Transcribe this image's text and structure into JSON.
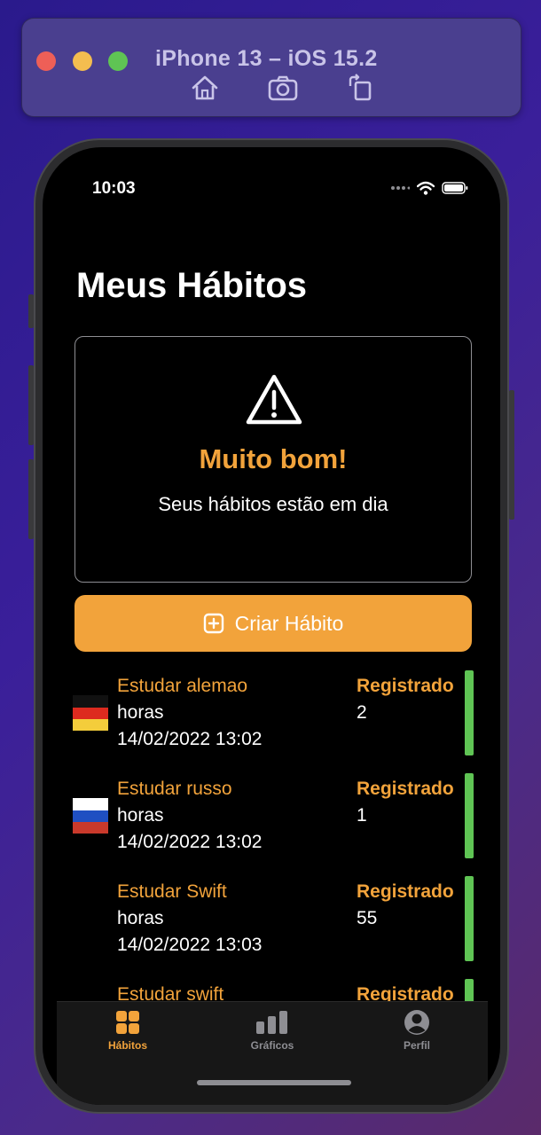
{
  "simulator": {
    "title": "iPhone 13 – iOS 15.2",
    "tools": [
      "home-icon",
      "screenshot-icon",
      "rotate-icon"
    ]
  },
  "status_bar": {
    "time": "10:03"
  },
  "page": {
    "title": "Meus Hábitos"
  },
  "alert": {
    "icon": "warning-icon",
    "title": "Muito bom!",
    "message": "Seus hábitos estão em dia"
  },
  "create_button": {
    "label": "Criar Hábito",
    "icon": "plus-square-icon"
  },
  "habits": [
    {
      "name": "Estudar alemao",
      "unit": "horas",
      "date": "14/02/2022 13:02",
      "status": "Registrado",
      "value": "2",
      "flag": "germany"
    },
    {
      "name": "Estudar russo",
      "unit": "horas",
      "date": "14/02/2022 13:02",
      "status": "Registrado",
      "value": "1",
      "flag": "russia"
    },
    {
      "name": "Estudar Swift",
      "unit": "horas",
      "date": "14/02/2022 13:03",
      "status": "Registrado",
      "value": "55",
      "flag": ""
    },
    {
      "name": "Estudar swift",
      "unit": "",
      "date": "",
      "status": "Registrado",
      "value": "",
      "flag": ""
    }
  ],
  "tabs": [
    {
      "label": "Hábitos",
      "icon": "grid-icon",
      "active": true
    },
    {
      "label": "Gráficos",
      "icon": "chart-icon",
      "active": false
    },
    {
      "label": "Perfil",
      "icon": "person-icon",
      "active": false
    }
  ],
  "colors": {
    "accent": "#f2a33b",
    "success": "#5fc454",
    "inactive": "#8e8e93"
  }
}
